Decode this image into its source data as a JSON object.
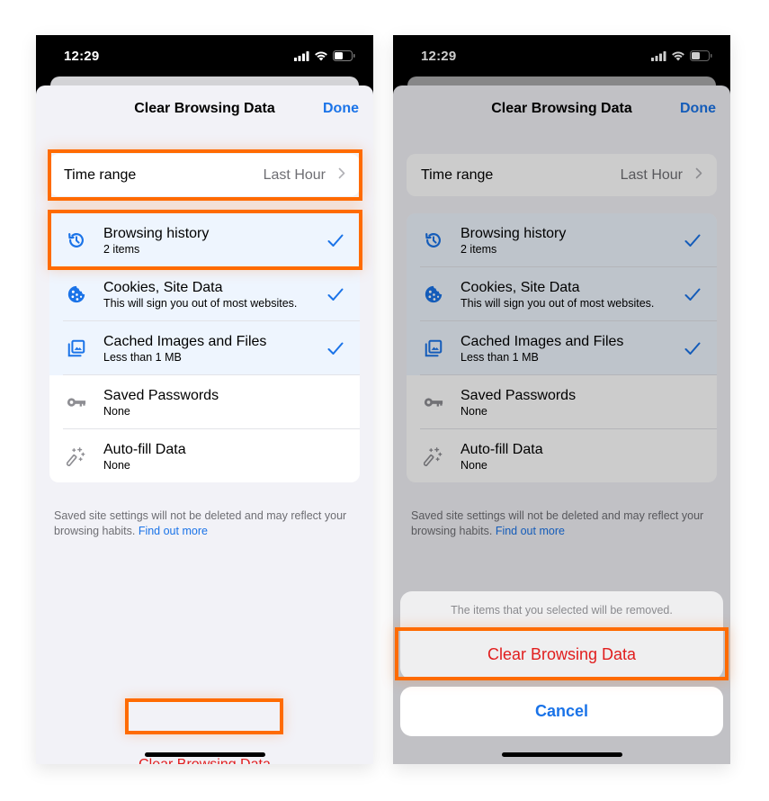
{
  "colors": {
    "accent_blue": "#1a73e8",
    "destructive_red": "#e11d1d",
    "highlight_orange": "#ff6b00",
    "sheet_bg": "#f2f2f7",
    "selected_row_bg": "#eef5fe"
  },
  "screens": [
    {
      "status_bar": {
        "time": "12:29",
        "icons": [
          "cellular-signal-icon",
          "wifi-icon",
          "battery-icon"
        ]
      },
      "sheet": {
        "title": "Clear Browsing Data",
        "done_label": "Done",
        "time_range": {
          "label": "Time range",
          "value": "Last Hour",
          "icon": "chevron-right-icon"
        },
        "items": [
          {
            "title": "Browsing history",
            "subtitle": "2 items",
            "icon": "history-icon",
            "checked": true
          },
          {
            "title": "Cookies, Site Data",
            "subtitle": "This will sign you out of most websites.",
            "icon": "cookie-icon",
            "checked": true
          },
          {
            "title": "Cached Images and Files",
            "subtitle": "Less than 1 MB",
            "icon": "image-stack-icon",
            "checked": true
          },
          {
            "title": "Saved Passwords",
            "subtitle": "None",
            "icon": "key-icon",
            "checked": false
          },
          {
            "title": "Auto-fill Data",
            "subtitle": "None",
            "icon": "magic-wand-icon",
            "checked": false
          }
        ],
        "footnote": "Saved site settings will not be deleted and may reflect your browsing habits.",
        "footnote_link": "Find out more",
        "clear_button": "Clear Browsing Data"
      },
      "highlights": [
        "time-range-row",
        "browsing-history-row",
        "clear-browsing-data-button"
      ]
    },
    {
      "status_bar": {
        "time": "12:29",
        "icons": [
          "cellular-signal-icon",
          "wifi-icon",
          "battery-icon"
        ]
      },
      "sheet": {
        "title": "Clear Browsing Data",
        "done_label": "Done",
        "time_range": {
          "label": "Time range",
          "value": "Last Hour",
          "icon": "chevron-right-icon"
        },
        "items": [
          {
            "title": "Browsing history",
            "subtitle": "2 items",
            "icon": "history-icon",
            "checked": true
          },
          {
            "title": "Cookies, Site Data",
            "subtitle": "This will sign you out of most websites.",
            "icon": "cookie-icon",
            "checked": true
          },
          {
            "title": "Cached Images and Files",
            "subtitle": "Less than 1 MB",
            "icon": "image-stack-icon",
            "checked": true
          },
          {
            "title": "Saved Passwords",
            "subtitle": "None",
            "icon": "key-icon",
            "checked": false
          },
          {
            "title": "Auto-fill Data",
            "subtitle": "None",
            "icon": "magic-wand-icon",
            "checked": false
          }
        ],
        "footnote": "Saved site settings will not be deleted and may reflect your browsing habits.",
        "footnote_link": "Find out more"
      },
      "action_sheet": {
        "message": "The items that you selected will be removed.",
        "confirm_label": "Clear Browsing Data",
        "cancel_label": "Cancel"
      },
      "highlights": [
        "action-sheet-clear-button"
      ]
    }
  ]
}
